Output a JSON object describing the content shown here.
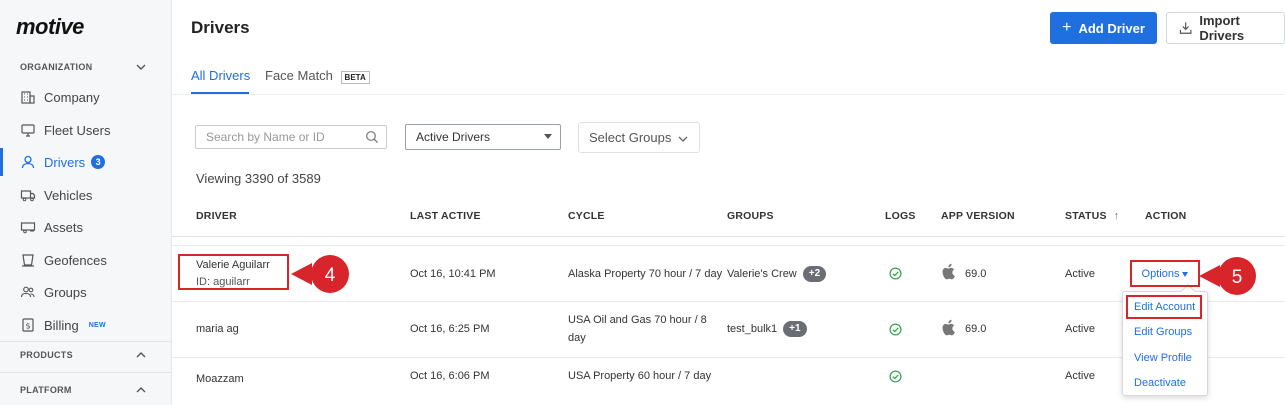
{
  "sidebar": {
    "logo": "motive",
    "section_org": "ORGANIZATION",
    "section_products": "PRODUCTS",
    "section_platform": "PLATFORM",
    "items": [
      {
        "label": "Company"
      },
      {
        "label": "Fleet Users"
      },
      {
        "label": "Drivers",
        "badge": "3"
      },
      {
        "label": "Vehicles"
      },
      {
        "label": "Assets"
      },
      {
        "label": "Geofences"
      },
      {
        "label": "Groups"
      },
      {
        "label": "Billing",
        "badge": "NEW"
      }
    ]
  },
  "header": {
    "title": "Drivers",
    "add_driver": "Add Driver",
    "import_drivers": "Import Drivers"
  },
  "tabs": {
    "all_drivers": "All Drivers",
    "face_match": "Face Match",
    "beta": "BETA"
  },
  "filters": {
    "search_placeholder": "Search by Name or ID",
    "status_select": "Active Drivers",
    "groups_select": "Select Groups",
    "viewing": "Viewing 3390 of 3589"
  },
  "table": {
    "columns": {
      "driver": "DRIVER",
      "last_active": "LAST ACTIVE",
      "cycle": "CYCLE",
      "groups": "GROUPS",
      "logs": "LOGS",
      "app_version": "APP VERSION",
      "status": "STATUS",
      "action": "ACTION"
    },
    "sort_indicator": "↑",
    "rows": [
      {
        "driver": "Valerie Aguilarr",
        "driver_id": "ID: aguilarr",
        "last_active": "Oct 16, 10:41 PM",
        "cycle": "Alaska Property 70 hour / 7 day",
        "group": "Valerie's Crew",
        "group_extra": "+2",
        "app_version": "69.0",
        "status": "Active"
      },
      {
        "driver": "maria ag",
        "last_active": "Oct 16, 6:25 PM",
        "cycle_line1": "USA Oil and Gas 70 hour / 8",
        "cycle_line2": "day",
        "group": "test_bulk1",
        "group_extra": "+1",
        "app_version": "69.0",
        "status": "Active"
      },
      {
        "driver": "Moazzam",
        "last_active": "Oct 16, 6:06 PM",
        "cycle": "USA Property 60 hour / 7 day",
        "status": "Active"
      }
    ]
  },
  "options_menu": {
    "button": "Options",
    "items": [
      "Edit Account",
      "Edit Groups",
      "View Profile",
      "Deactivate"
    ]
  },
  "annotations": {
    "step4": "4",
    "step5": "5",
    "color": "#d8252b"
  },
  "colors": {
    "accent": "#1f6fe0",
    "success": "#3aa655"
  }
}
